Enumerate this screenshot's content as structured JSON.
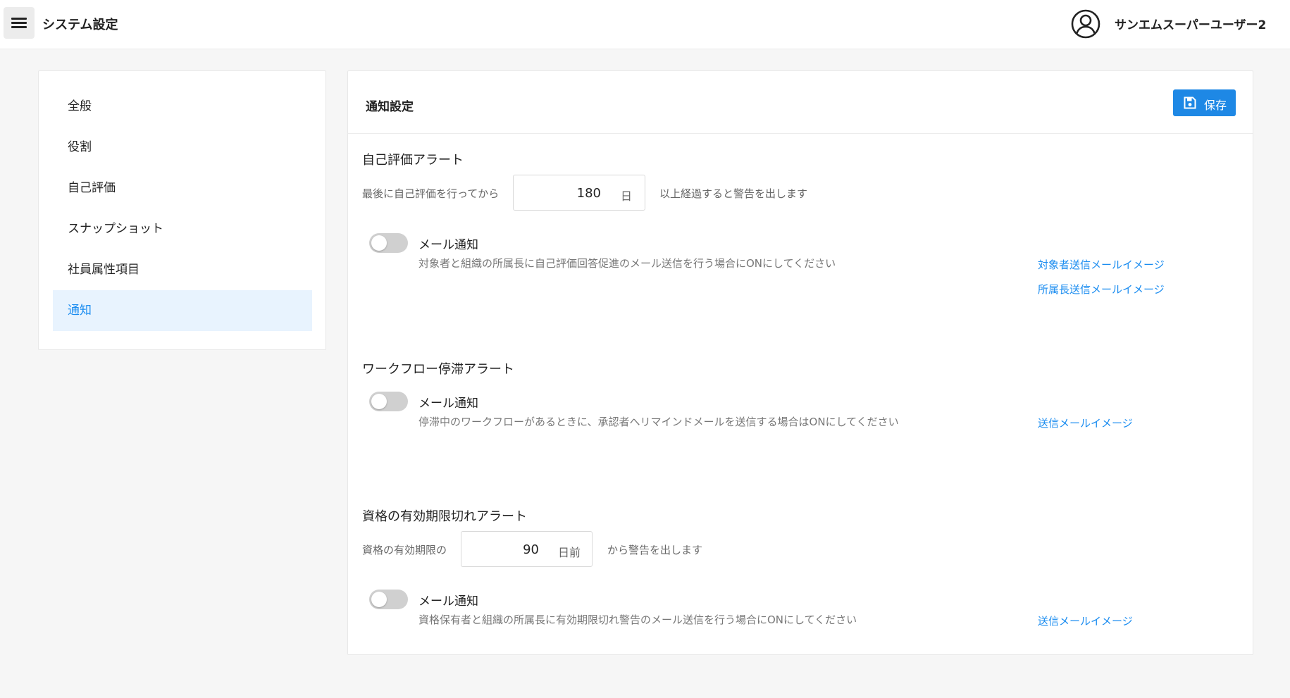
{
  "header": {
    "menu_icon": "hamburger-menu-icon",
    "title": "システム設定",
    "avatar_icon": "account-circle-icon",
    "user_name": "サンエムスーパーユーザー2"
  },
  "sidebar": {
    "items": [
      {
        "label": "全般"
      },
      {
        "label": "役割"
      },
      {
        "label": "自己評価"
      },
      {
        "label": "スナップショット"
      },
      {
        "label": "社員属性項目"
      },
      {
        "label": "通知",
        "active": true
      }
    ]
  },
  "panel": {
    "title": "通知設定",
    "save_label": "保存",
    "save_icon": "floppy-disk-icon",
    "sections": [
      {
        "title": "自己評価アラート",
        "prefix": "最後に自己評価を行ってから",
        "value": "180",
        "unit": "日",
        "suffix": "以上経過すると警告を出します",
        "mail_label": "メール通知",
        "mail_desc": "対象者と組織の所属長に自己評価回答促進のメール送信を行う場合にONにしてください",
        "toggle_on": false,
        "links": [
          "対象者送信メールイメージ",
          "所属長送信メールイメージ"
        ]
      },
      {
        "title": "ワークフロー停滞アラート",
        "mail_label": "メール通知",
        "mail_desc": "停滞中のワークフローがあるときに、承認者へリマインドメールを送信する場合はONにしてください",
        "toggle_on": false,
        "links": [
          "送信メールイメージ"
        ]
      },
      {
        "title": "資格の有効期限切れアラート",
        "prefix": "資格の有効期限の",
        "value": "90",
        "unit": "日前",
        "suffix": "から警告を出します",
        "mail_label": "メール通知",
        "mail_desc": "資格保有者と組織の所属長に有効期限切れ警告のメール送信を行う場合にONにしてください",
        "toggle_on": false,
        "links": [
          "送信メールイメージ"
        ]
      }
    ]
  },
  "colors": {
    "accent": "#1e88e5",
    "link": "#1a8cf0",
    "active_bg": "#e8f3fe",
    "background": "#f6f6f6"
  }
}
